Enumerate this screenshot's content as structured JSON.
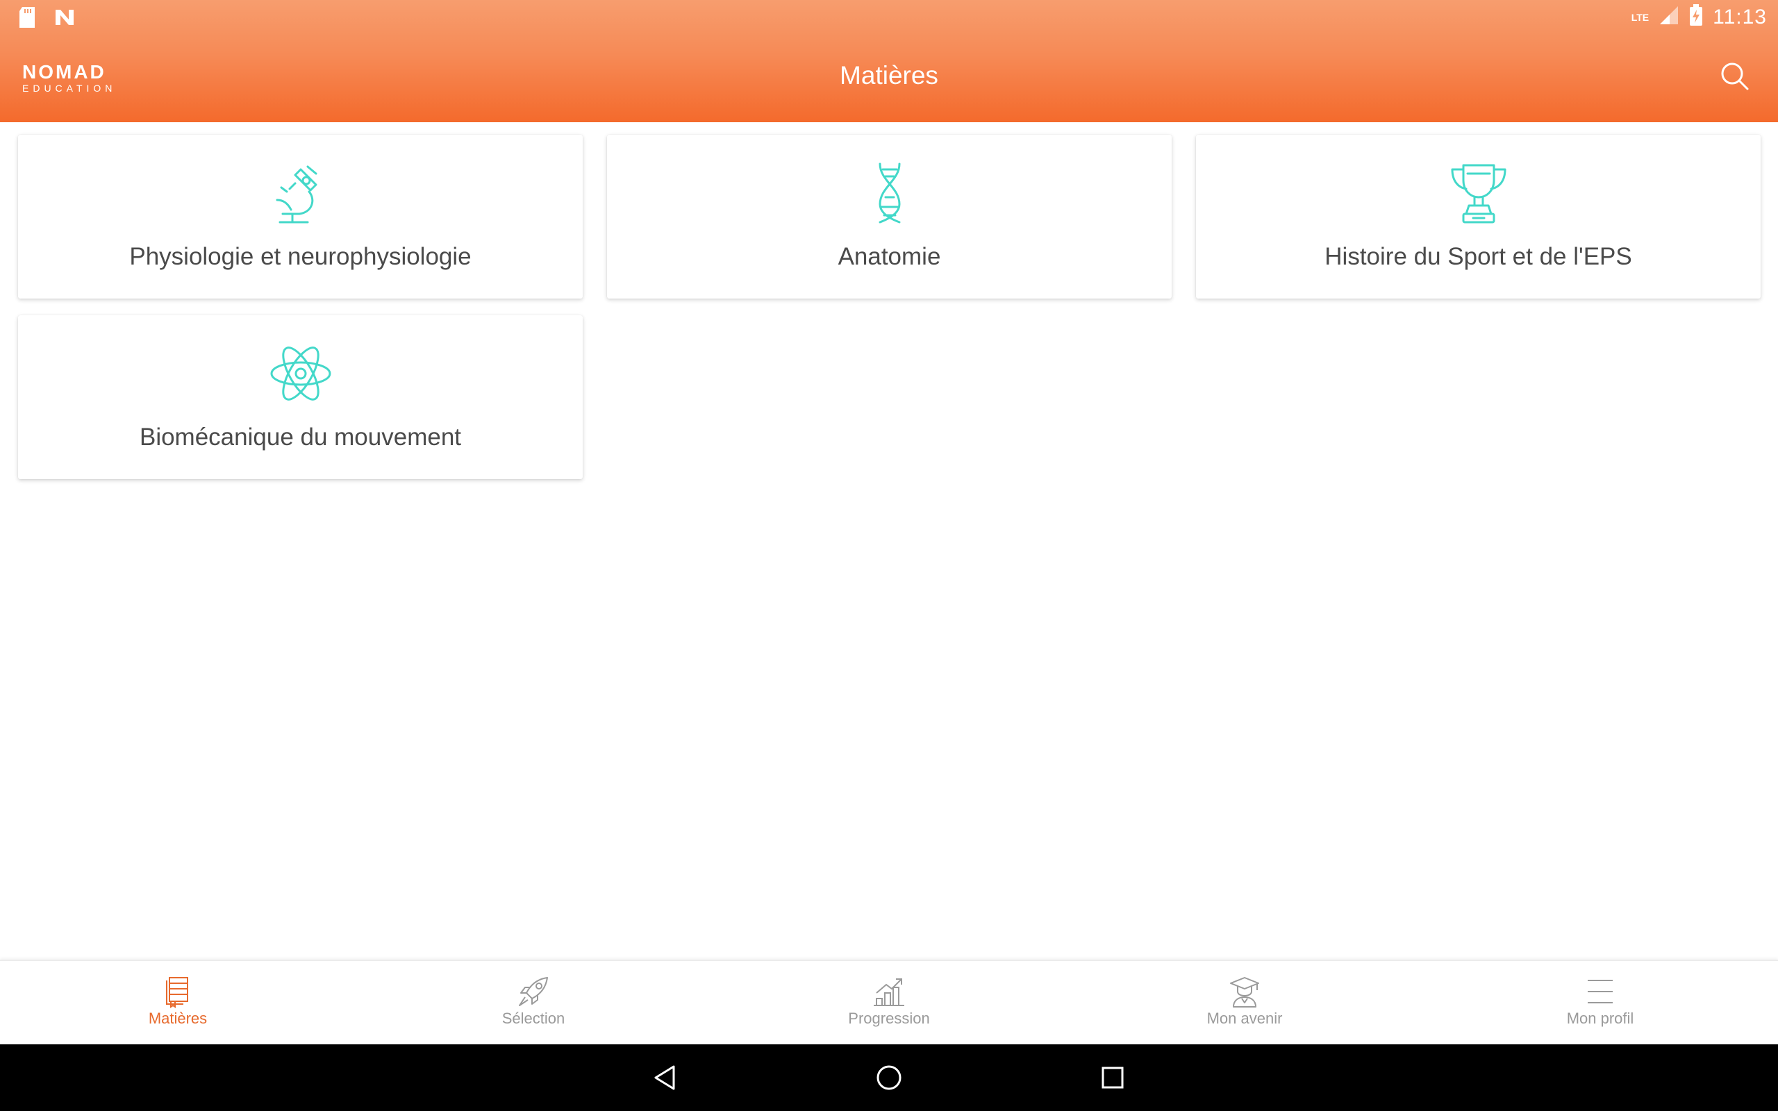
{
  "status_bar": {
    "time": "11:13",
    "network": "LTE",
    "left_icons": [
      "sd-card-icon",
      "n-notification-icon"
    ],
    "right_icons": [
      "signal-icon",
      "battery-charging-icon"
    ]
  },
  "app_bar": {
    "logo_main": "NOMAD",
    "logo_sub": "EDUCATION",
    "title": "Matières",
    "search_icon": "search-icon"
  },
  "subjects": [
    {
      "label": "Physiologie et neurophysiologie",
      "icon": "microscope-icon"
    },
    {
      "label": "Anatomie",
      "icon": "dna-icon"
    },
    {
      "label": "Histoire du Sport et de l'EPS",
      "icon": "trophy-icon"
    },
    {
      "label": "Biomécanique du mouvement",
      "icon": "atom-icon"
    }
  ],
  "bottom_nav": {
    "active": "Matières",
    "items": [
      {
        "label": "Matières",
        "icon": "notebook-icon"
      },
      {
        "label": "Sélection",
        "icon": "rocket-icon"
      },
      {
        "label": "Progression",
        "icon": "chart-icon"
      },
      {
        "label": "Mon avenir",
        "icon": "graduate-icon"
      },
      {
        "label": "Mon profil",
        "icon": "menu-icon"
      }
    ]
  },
  "colors": {
    "accent": "#f46a2c",
    "icon_teal": "#43d8c9",
    "active_nav": "#e76a2d",
    "inactive_nav": "#9a9a9a",
    "card_text": "#4a4a4a"
  }
}
